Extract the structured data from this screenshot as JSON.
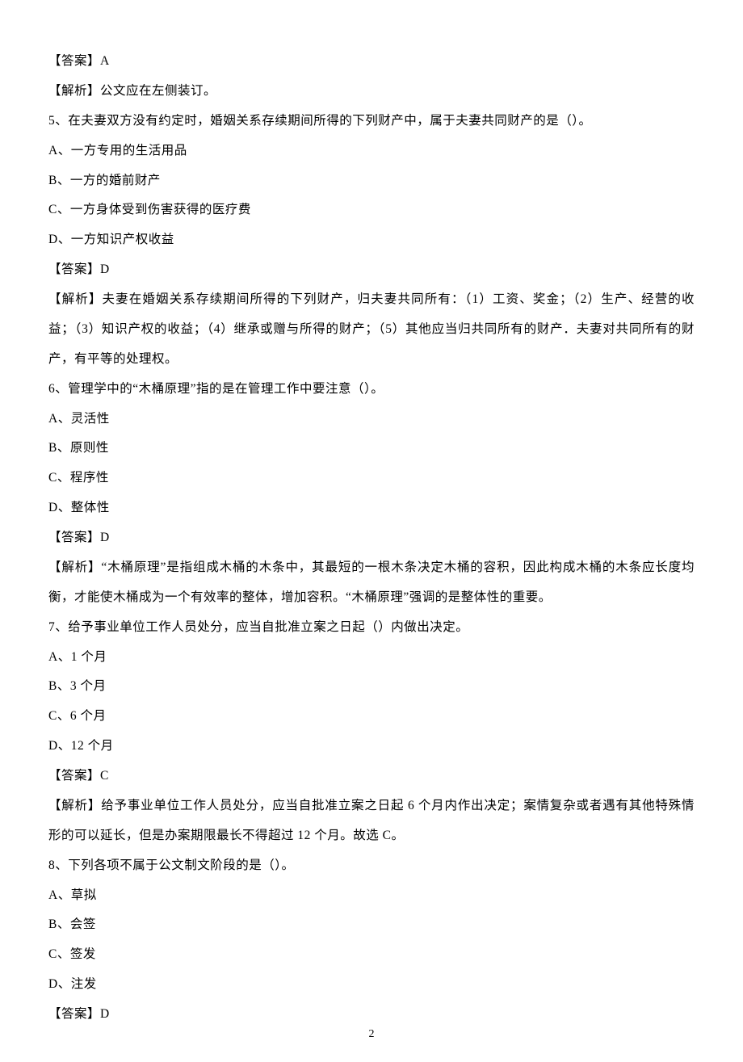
{
  "page_number": "2",
  "items": [
    {
      "answer_label": "【答案】A",
      "analysis": "【解析】公文应在左侧装订。"
    },
    {
      "number": "5、",
      "question": "在夫妻双方没有约定时，婚姻关系存续期间所得的下列财产中，属于夫妻共同财产的是（）。",
      "options": [
        "A、一方专用的生活用品",
        "B、一方的婚前财产",
        "C、一方身体受到伤害获得的医疗费",
        "D、一方知识产权收益"
      ],
      "answer_label": "【答案】D",
      "analysis": "【解析】夫妻在婚姻关系存续期间所得的下列财产，归夫妻共同所有：（1）工资、奖金；（2）生产、经营的收益；（3）知识产权的收益；（4）继承或赠与所得的财产；（5）其他应当归共同所有的财产．夫妻对共同所有的财产，有平等的处理权。"
    },
    {
      "number": "6、",
      "question": "管理学中的“木桶原理”指的是在管理工作中要注意（）。",
      "options": [
        "A、灵活性",
        "B、原则性",
        "C、程序性",
        "D、整体性"
      ],
      "answer_label": "【答案】D",
      "analysis": "【解析】“木桶原理”是指组成木桶的木条中，其最短的一根木条决定木桶的容积，因此构成木桶的木条应长度均衡，才能使木桶成为一个有效率的整体，增加容积。“木桶原理”强调的是整体性的重要。"
    },
    {
      "number": "7、",
      "question": "给予事业单位工作人员处分，应当自批准立案之日起（）内做出决定。",
      "options": [
        "A、1 个月",
        "B、3 个月",
        "C、6 个月",
        "D、12 个月"
      ],
      "answer_label": "【答案】C",
      "analysis": "【解析】给予事业单位工作人员处分，应当自批准立案之日起 6 个月内作出决定；案情复杂或者遇有其他特殊情形的可以延长，但是办案期限最长不得超过 12 个月。故选 C。"
    },
    {
      "number": "8、",
      "question": "下列各项不属于公文制文阶段的是（）。",
      "options": [
        "A、草拟",
        "B、会签",
        "C、签发",
        "D、注发"
      ],
      "answer_label": "【答案】D"
    }
  ]
}
